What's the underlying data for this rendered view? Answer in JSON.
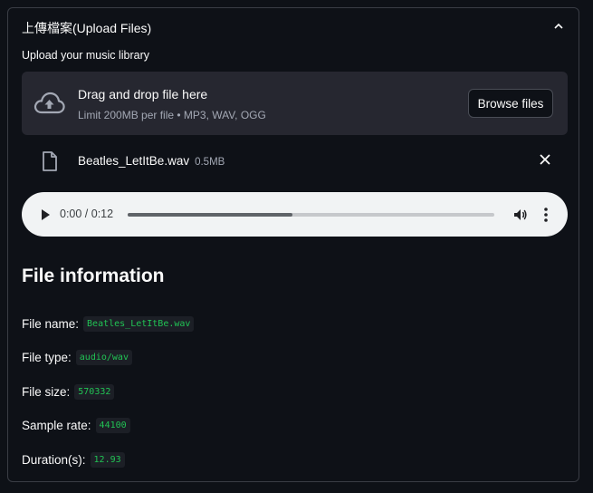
{
  "expander": {
    "title": "上傳檔案(Upload Files)",
    "chevron": "chevron-up-icon"
  },
  "uploader": {
    "label": "Upload your music library",
    "dropzone_title": "Drag and drop file here",
    "dropzone_subtitle": "Limit 200MB per file • MP3, WAV, OGG",
    "browse_label": "Browse files",
    "icon": "cloud-upload-icon"
  },
  "uploaded_file": {
    "name": "Beatles_LetItBe.wav",
    "size": "0.5MB",
    "icon": "file-icon"
  },
  "audio_player": {
    "time": "0:00 / 0:12",
    "progress": 0.45
  },
  "file_info": {
    "title": "File information",
    "rows": [
      {
        "label": "File name:",
        "value": "Beatles_LetItBe.wav"
      },
      {
        "label": "File type:",
        "value": "audio/wav"
      },
      {
        "label": "File size:",
        "value": "570332"
      },
      {
        "label": "Sample rate:",
        "value": "44100"
      },
      {
        "label": "Duration(s):",
        "value": "12.93"
      }
    ]
  },
  "colors": {
    "background": "#0e1117",
    "panel": "#262730",
    "code_text": "#21c354",
    "audio_bg": "#f1f3f4"
  }
}
